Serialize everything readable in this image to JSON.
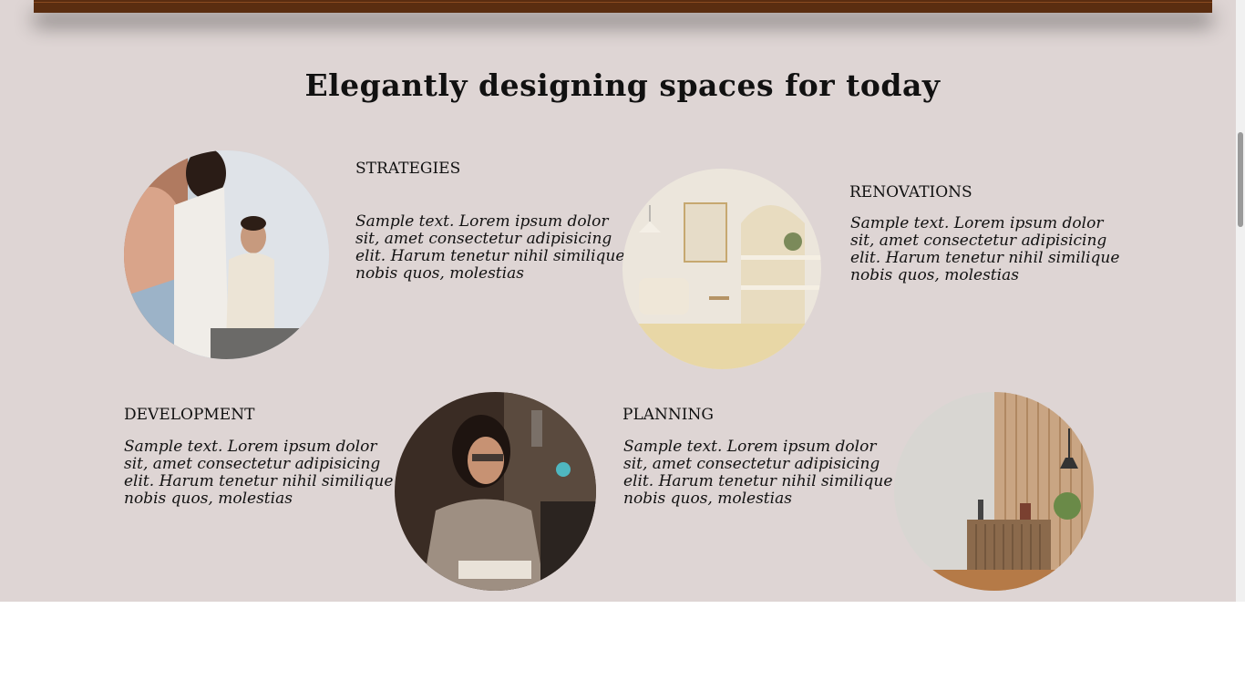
{
  "page": {
    "title": "Elegantly designing spaces for today"
  },
  "features": [
    {
      "heading": "STRATEGIES",
      "text": "Sample text. Lorem ipsum dolor sit, amet consectetur adipisicing elit. Harum tenetur nihil similique nobis quos, molestias",
      "image": "team-meeting-photo"
    },
    {
      "heading": "RENOVATIONS",
      "text": "Sample text. Lorem ipsum dolor sit, amet consectetur adipisicing elit. Harum tenetur nihil similique nobis quos, molestias",
      "image": "living-room-photo"
    },
    {
      "heading": "DEVELOPMENT",
      "text": "Sample text. Lorem ipsum dolor sit, amet consectetur adipisicing elit. Harum tenetur nihil similique nobis quos, molestias",
      "image": "woman-working-photo"
    },
    {
      "heading": "PLANNING",
      "text": "Sample text. Lorem ipsum dolor sit, amet consectetur adipisicing elit. Harum tenetur nihil similique nobis quos, molestias",
      "image": "cabinet-interior-photo"
    }
  ],
  "colors": {
    "background": "#ded5d4",
    "header_bar": "#5a2d10"
  }
}
